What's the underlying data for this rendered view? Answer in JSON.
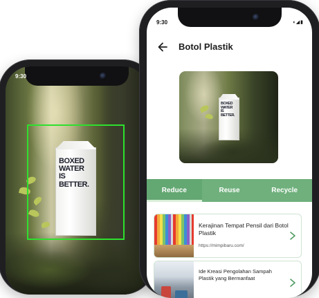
{
  "left_phone": {
    "status_time": "9:30",
    "carton_text": [
      "BOXED",
      "WATER",
      "IS",
      "BETTER."
    ]
  },
  "right_phone": {
    "status_time": "9:30",
    "status_icons": "wifi-icon signal-icon battery-icon",
    "header": {
      "title": "Botol Plastik"
    },
    "product_carton_text": [
      "BOXED",
      "WATER",
      "IS",
      "BETTER."
    ],
    "tabs": [
      {
        "label": "Reduce",
        "active": true
      },
      {
        "label": "Reuse",
        "active": false
      },
      {
        "label": "Recycle",
        "active": false
      }
    ],
    "articles": [
      {
        "title": "Kerajinan Tempat Pensil dari Botol Plastik",
        "url": "https://mimpibaru.com/"
      },
      {
        "title": "Ide Kreasi Pengolahan Sampah Plastik yang Bermanfaat",
        "url": ""
      }
    ]
  },
  "colors": {
    "accent_green": "#6fb07c",
    "scan_box": "#2ee02e",
    "chevron": "#4f9b62"
  }
}
